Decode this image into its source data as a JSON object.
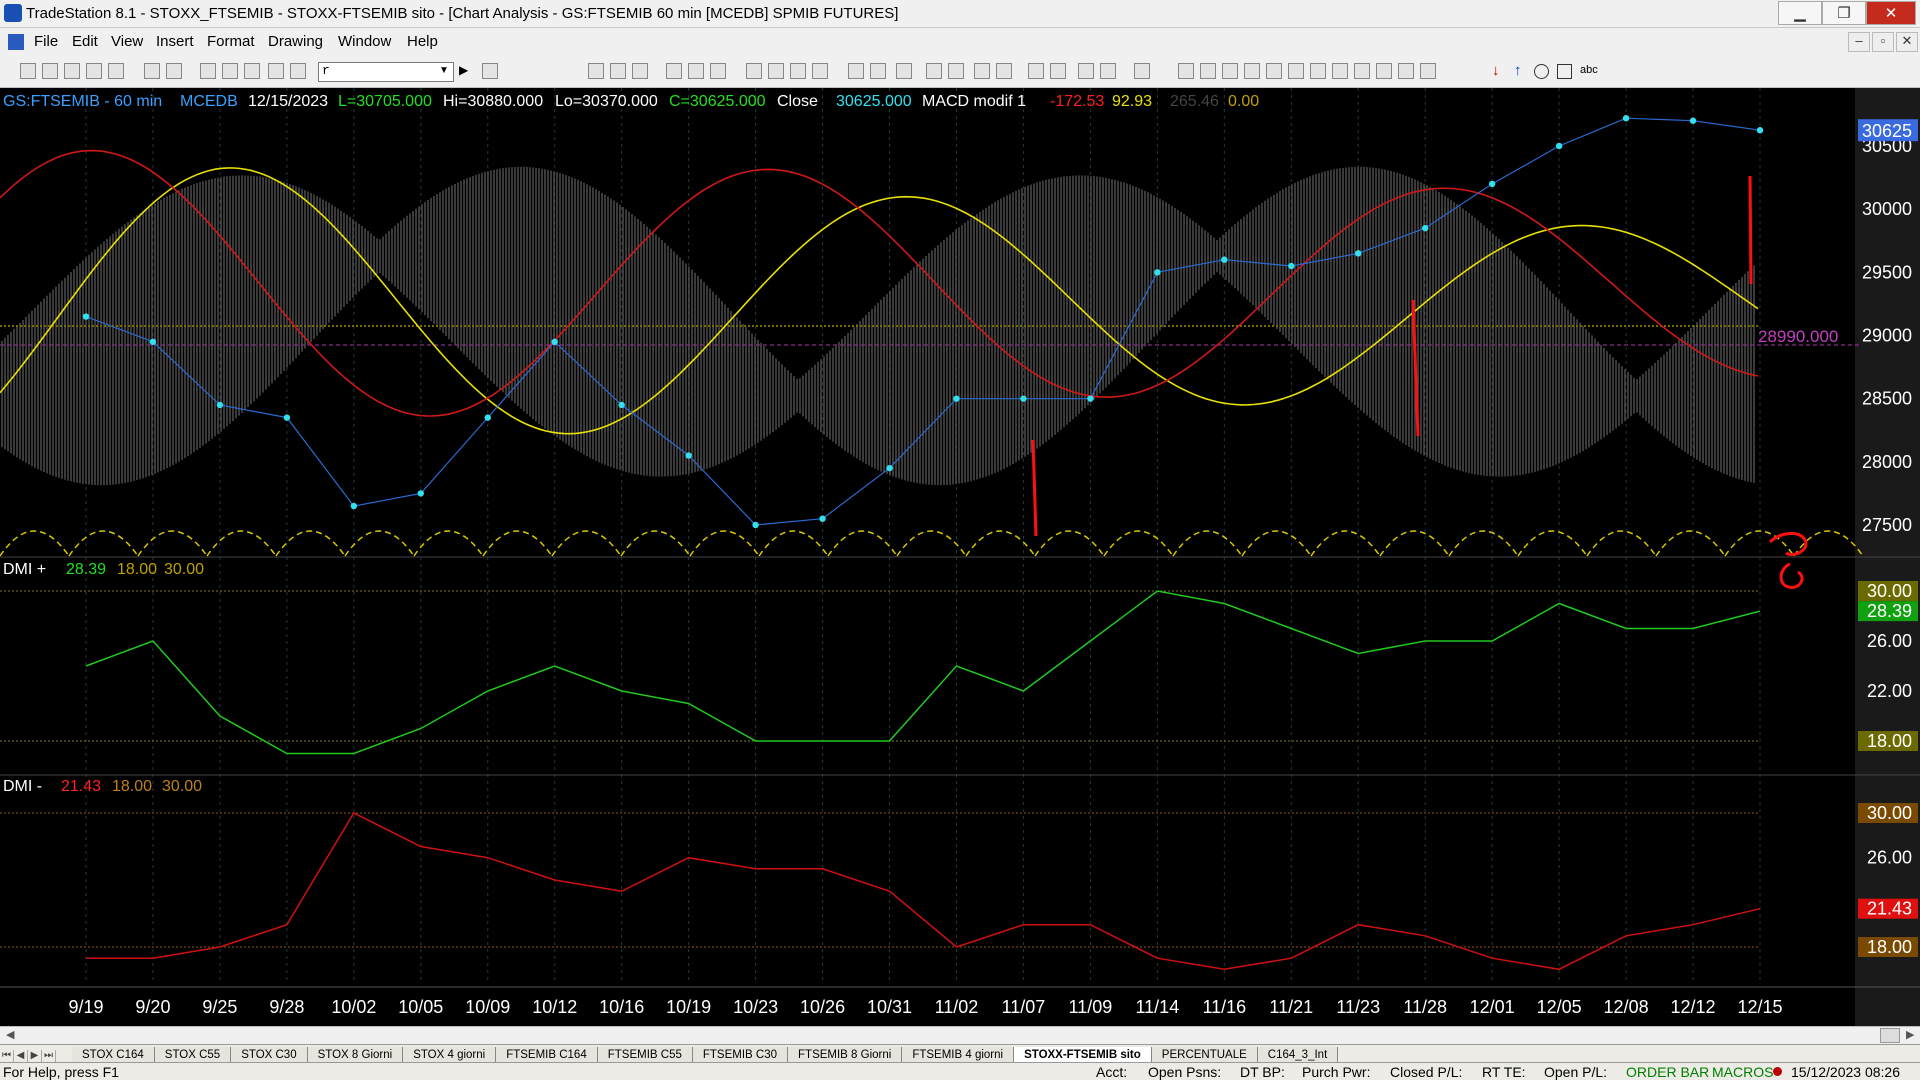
{
  "window": {
    "title": "TradeStation 8.1 - STOXX_FTSEMIB - STOXX-FTSEMIB sito - [Chart Analysis - GS:FTSEMIB  60 min  [MCEDB] SPMIB FUTURES]",
    "minimize": "▁",
    "maximize": "❐",
    "close": "✕"
  },
  "menu": [
    "File",
    "Edit",
    "View",
    "Insert",
    "Format",
    "Drawing",
    "Window",
    "Help"
  ],
  "mdi_controls": [
    "–",
    "▫",
    "✕"
  ],
  "toolbar": {
    "combo_value": "r"
  },
  "chart": {
    "header": {
      "symbol": "GS:FTSEMIB - 60 min",
      "code": "MCEDB",
      "date": "12/15/2023",
      "last": "L=30705.000",
      "high": "Hi=30880.000",
      "low": "Lo=30370.000",
      "close": "C=30625.000",
      "close_label": "Close",
      "close_value": "30625.000",
      "indicator": "MACD modif 1",
      "v1": "-172.53",
      "v2": "92.93",
      "v3": "265.46",
      "v4": "0.00"
    },
    "dmi_plus_header": {
      "name": "DMI +",
      "v1": "28.39",
      "v2": "18.00",
      "v3": "30.00"
    },
    "dmi_minus_header": {
      "name": "DMI -",
      "v1": "21.43",
      "v2": "18.00",
      "v3": "30.00"
    },
    "price_axis": [
      "30500",
      "30000",
      "29500",
      "29000",
      "28500",
      "28000",
      "27500"
    ],
    "price_current": "30625",
    "price_level_label": "28990.000",
    "dmi_plus_axis": [
      "30.00",
      "26.00",
      "22.00",
      "18.00"
    ],
    "dmi_plus_current": "28.39",
    "dmi_minus_axis": [
      "30.00",
      "26.00",
      "18.00"
    ],
    "dmi_minus_current": "21.43",
    "x_axis": [
      "9/19",
      "9/20",
      "9/25",
      "9/28",
      "10/02",
      "10/05",
      "10/09",
      "10/12",
      "10/16",
      "10/19",
      "10/23",
      "10/26",
      "10/31",
      "11/02",
      "11/07",
      "11/09",
      "11/14",
      "11/16",
      "11/21",
      "11/23",
      "11/28",
      "12/01",
      "12/05",
      "12/08",
      "12/12",
      "12/15"
    ],
    "colors": {
      "price": "#33e0f0",
      "macd_red": "#e02020",
      "macd_yellow": "#e8e000",
      "dmi_plus": "#20d020",
      "dmi_minus": "#e01818",
      "hist": "#6a6a6a"
    }
  },
  "chart_data": {
    "type": "line",
    "title": "GS:FTSEMIB - 60 min",
    "ylim": [
      27300,
      30900
    ],
    "x": [
      "9/19",
      "9/20",
      "9/25",
      "9/28",
      "10/02",
      "10/05",
      "10/09",
      "10/12",
      "10/16",
      "10/19",
      "10/23",
      "10/26",
      "10/31",
      "11/02",
      "11/07",
      "11/09",
      "11/14",
      "11/16",
      "11/21",
      "11/23",
      "11/28",
      "12/01",
      "12/05",
      "12/08",
      "12/12",
      "12/15"
    ],
    "series": [
      {
        "name": "Close",
        "values": [
          29150,
          28950,
          28450,
          28350,
          27650,
          27750,
          28350,
          28950,
          28450,
          28050,
          27500,
          27550,
          27950,
          28500,
          28500,
          28500,
          29500,
          29600,
          29550,
          29650,
          29850,
          30200,
          30500,
          30720,
          30700,
          30625
        ]
      },
      {
        "name": "DMI +",
        "values": [
          24,
          26,
          20,
          17,
          17,
          19,
          22,
          24,
          22,
          21,
          18,
          18,
          18,
          24,
          22,
          26,
          30,
          29,
          27,
          25,
          26,
          26,
          29,
          27,
          27,
          28.39
        ]
      },
      {
        "name": "DMI -",
        "values": [
          17,
          17,
          18,
          20,
          30,
          27,
          26,
          24,
          23,
          26,
          25,
          25,
          23,
          18,
          20,
          20,
          17,
          16,
          17,
          20,
          19,
          17,
          16,
          19,
          20,
          21.43
        ]
      }
    ]
  },
  "tabs": [
    "STOX C164",
    "STOX C55",
    "STOX  C30",
    "STOX  8 Giorni",
    "STOX 4 giorni",
    "FTSEMIB C164",
    "FTSEMIB C55",
    "FTSEMIB C30",
    "FTSEMIB  8 Giorni",
    "FTSEMIB  4 giorni",
    "STOXX-FTSEMIB sito",
    "PERCENTUALE",
    "C164_3_Int"
  ],
  "active_tab": "STOXX-FTSEMIB sito",
  "status": {
    "help": "For Help, press F1",
    "acct": "Acct:",
    "open_psns": "Open Psns:",
    "dt_bp": "DT BP:",
    "purch_pwr": "Purch Pwr:",
    "closed_pl": "Closed P/L:",
    "rt_te": "RT TE:",
    "open_pl": "Open P/L:",
    "order_bar": "ORDER BAR",
    "macros": "MACROS",
    "datetime": "15/12/2023 08:26"
  }
}
